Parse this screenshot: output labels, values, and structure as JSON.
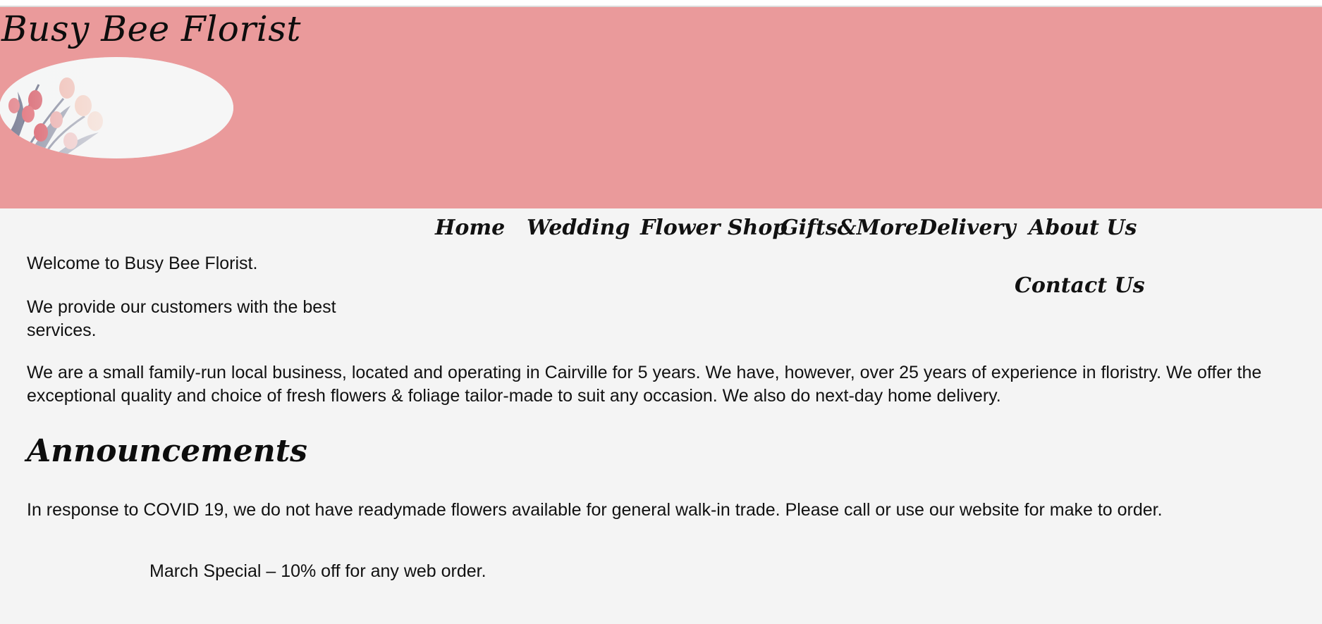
{
  "header": {
    "site_title": "Busy Bee Florist",
    "background_color": "#ea9a9b",
    "logo": "tulip-bouquet-oval-logo"
  },
  "nav": {
    "items": [
      {
        "label": "Home"
      },
      {
        "label": "Wedding"
      },
      {
        "label": "Flower Shop"
      },
      {
        "label": "Gifts&More"
      },
      {
        "label": "Delivery"
      },
      {
        "label": "About Us"
      },
      {
        "label": "Contact Us"
      }
    ]
  },
  "main": {
    "welcome": "Welcome to Busy Bee Florist.",
    "provide": "We provide our customers with the best services.",
    "about": "We are a small family-run local business, located and operating in Cairville for 5 years. We have, however, over 25 years of experience in floristry. We offer the exceptional quality and choice of fresh flowers & foliage tailor-made to suit any occasion. We also do next-day home delivery.",
    "announcements_heading": "Announcements",
    "covid_notice": "In response to COVID 19, we do not have readymade flowers available for general walk-in trade. Please call or use our website for make to order.",
    "special": "March Special – 10% off for any web order."
  },
  "colors": {
    "page_background": "#f4f4f4",
    "text": "#111111"
  }
}
